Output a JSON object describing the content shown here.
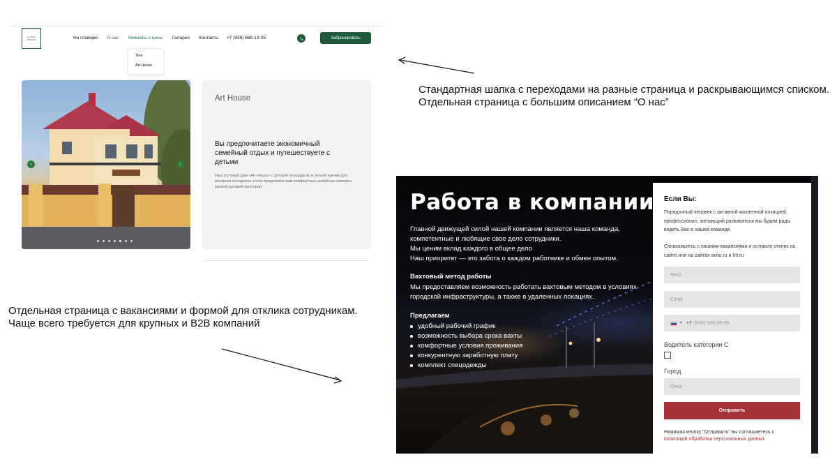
{
  "site": {
    "logo_text": [
      "CLASSY",
      "HOUSE"
    ],
    "nav": [
      "На главную",
      "О нас",
      "Комнаты и цены",
      "Галерея",
      "Контакты",
      "+7 (938) 888-13-05"
    ],
    "book_button": "Забронировать",
    "dropdown": [
      "Tere",
      "Art House"
    ],
    "card_title": "Art House",
    "card_heading": "Вы предпочитаете экономичный семейный отдых и путешествуете с детьми",
    "card_text": "Наш гостевой дом «Art House» с детской площадкой, и летней кухней для вечерних посиделок, готов предложить вам комфортные семейные комнаты разной ценовой категории",
    "slider_dots": 7,
    "slider_active": 4
  },
  "notes": {
    "top": "Стандартная шапка с переходами на разные страница и раскрывающимся списком.\nОтдельная страница с большим описанием “О нас”",
    "bottom": "Отдельная страница с вакансиями и формой для отклика сотрудникам.\nЧаще всего требуется для крупных и B2B компаний"
  },
  "career": {
    "title": "Работа в компании",
    "intro": "Главной движущей силой нашей компании является наша команда, компетентные и любящие свое дело сотрудники.\nМы ценим вклад каждого в общее дело\nНаш приоритет — это забота о каждом работнике и обмен опытом.",
    "watch_heading": "Вахтовый метод работы",
    "watch_text": "Мы предоставляем возможность работать вахтовым методом в условиях городской инфраструктуры, а также в удаленных локациях.",
    "offer_heading": "Предлагаем",
    "offer_items": [
      "удобный рабочий график",
      "возможность выбора срока вахты",
      "комфортные условия проживания",
      "конкурентную заработную плату",
      "комплект спецодежды"
    ]
  },
  "form": {
    "heading": "Если Вы:",
    "text1": "Порядочный человек с активной жизненной позицией, профессионал, желающий развиваться мы будем рады видеть Вас в нашей команде.",
    "text2": "Ознакомьтесь с нашими вакансиями и оставьте отклик на сайте или на сайтах avito.ru и hh.ru",
    "name_placeholder": "ФИО",
    "email_placeholder": "Email",
    "phone_code": "+7",
    "phone_placeholder": "(999) 999-99-99",
    "driver_label": "Водитель категории С",
    "city_label": "Город",
    "city_placeholder": "Омск",
    "submit": "Отправить",
    "consent": "Нажимая кнопку \"Отправить\" вы соглашаетесь с",
    "consent_link": "политикой обработки персональных данных"
  },
  "colors": {
    "green": "#1d5a3a",
    "red": "#a43236"
  }
}
